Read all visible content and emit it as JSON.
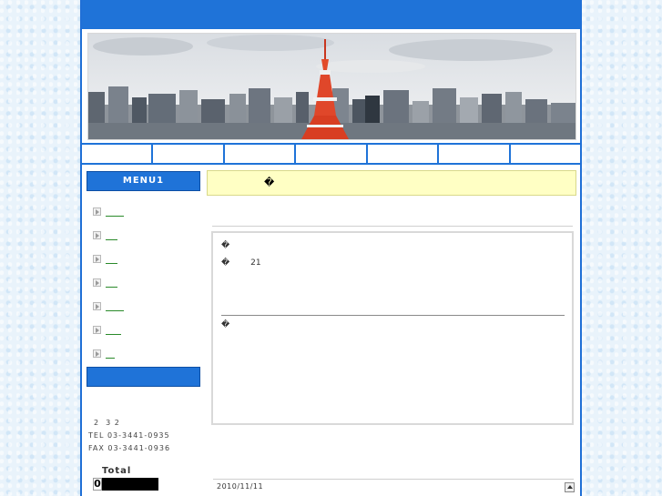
{
  "menu": {
    "header1": "MENU1",
    "items": [
      "",
      "",
      "",
      "",
      "",
      "",
      ""
    ]
  },
  "sidebar": {
    "address_line": "2  3 2",
    "tel": "TEL 03-3441-0935",
    "fax": "FAX 03-3441-0936",
    "total_label": "Total",
    "counter_digit": "0"
  },
  "main": {
    "notice_text": "�",
    "line1": "�",
    "line2": "�        21",
    "line3": "�",
    "date": "2010/11/11"
  },
  "colors": {
    "accent": "#1f73d8",
    "notice_bg": "#ffffc4",
    "link": "#2a8a2a"
  }
}
